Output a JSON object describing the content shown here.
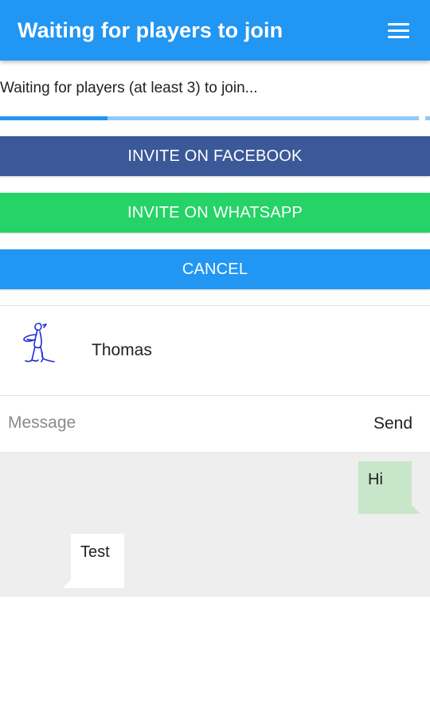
{
  "header": {
    "title": "Waiting for players to join",
    "menu_icon": "hamburger-menu-icon",
    "color": "#2196f3"
  },
  "status": {
    "text": "Waiting for players (at least 3) to join...",
    "progress_fraction": 0.25
  },
  "buttons": {
    "facebook_label": "INVITE ON FACEBOOK",
    "whatsapp_label": "INVITE ON WHATSAPP",
    "cancel_label": "CANCEL",
    "facebook_color": "#3b5998",
    "whatsapp_color": "#25d366",
    "cancel_color": "#2196f3"
  },
  "players": [
    {
      "name": "Thomas",
      "avatar": "doodle-avatar-icon"
    }
  ],
  "chat": {
    "input_placeholder": "Message",
    "input_value": "",
    "send_label": "Send",
    "messages": [
      {
        "text": "Hi",
        "direction": "outgoing"
      },
      {
        "text": "Test",
        "direction": "incoming"
      }
    ]
  }
}
